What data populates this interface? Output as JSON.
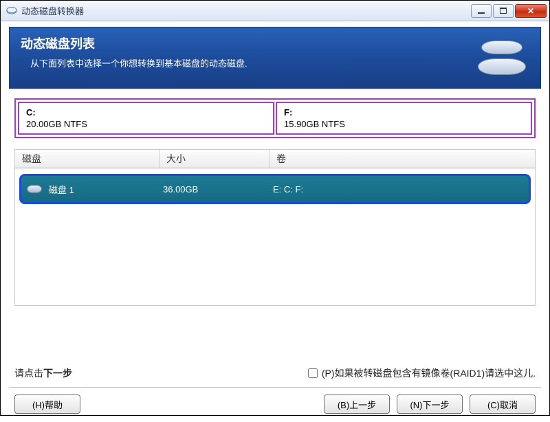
{
  "window": {
    "title": "动态磁盘转换器"
  },
  "banner": {
    "heading": "动态磁盘列表",
    "subtext": "从下面列表中选择一个你想转换到基本磁盘的动态磁盘."
  },
  "partitions": [
    {
      "drive": "C:",
      "details": "20.00GB NTFS"
    },
    {
      "drive": "F:",
      "details": "15.90GB NTFS"
    }
  ],
  "table": {
    "headers": {
      "disk": "磁盘",
      "size": "大小",
      "volumes": "卷"
    },
    "rows": [
      {
        "name": "磁盘 1",
        "size": "36.00GB",
        "volumes": "E:  C:  F:"
      }
    ]
  },
  "hint": {
    "left_prefix": "请点击",
    "left_bold": "下一步",
    "checkbox_label": "(P)如果被转磁盘包含有镜像卷(RAID1)请选中这儿."
  },
  "buttons": {
    "help": "(H)帮助",
    "back": "(B)上一步",
    "next": "(N)下一步",
    "cancel": "(C)取消"
  }
}
